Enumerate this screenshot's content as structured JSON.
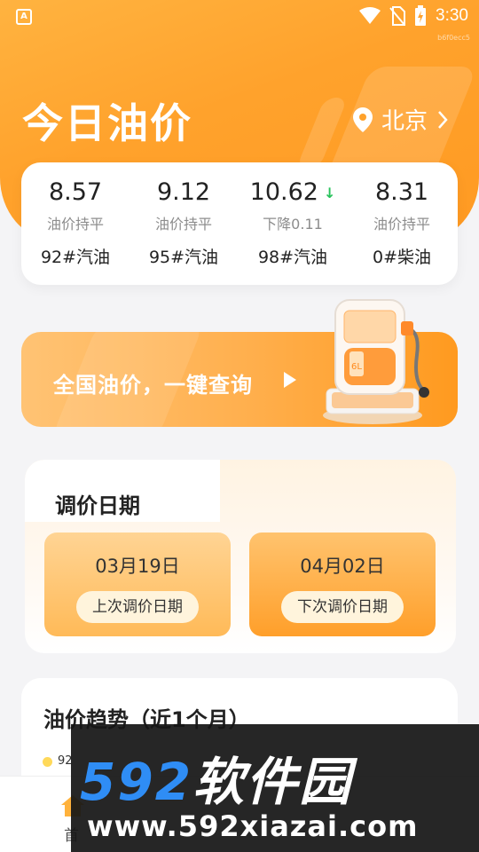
{
  "status_bar": {
    "app_badge": "A",
    "time": "3:30",
    "tiny_id": "b6f0ecc5"
  },
  "header": {
    "title": "今日油价",
    "location": "北京"
  },
  "prices": [
    {
      "value": "8.57",
      "status": "油价持平",
      "name": "92#汽油"
    },
    {
      "value": "9.12",
      "status": "油价持平",
      "name": "95#汽油"
    },
    {
      "value": "10.62",
      "status": "下降0.11",
      "name": "98#汽油",
      "trend": "down"
    },
    {
      "value": "8.31",
      "status": "油价持平",
      "name": "0#柴油"
    }
  ],
  "banner": {
    "text": "全国油价，一键查询",
    "pump_label": "6L"
  },
  "adjust": {
    "title": "调价日期",
    "prev_date": "03月19日",
    "prev_label": "上次调价日期",
    "next_date": "04月02日",
    "next_label": "下次调价日期"
  },
  "trend": {
    "title": "油价趋势（近1个月）",
    "legend_partial": "92"
  },
  "bottom_nav": {
    "home_label_partial": "首"
  },
  "watermark": {
    "brand_num": "592",
    "brand_cn": "软件园",
    "url": "www.592xiazai.com"
  },
  "colors": {
    "accent": "#ffa22c",
    "down": "#27c25b",
    "watermark_blue": "#2f8df5"
  }
}
